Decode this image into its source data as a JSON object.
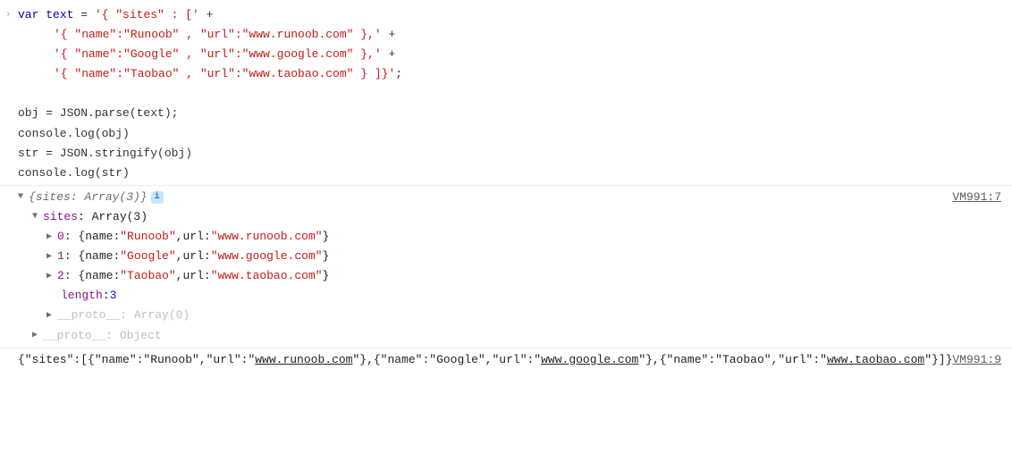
{
  "input": {
    "line1_kw": "var",
    "line1_var": "text",
    "line1_eq": " = ",
    "line1_str": "'{ \"sites\" : ['",
    "line1_plus": " +",
    "line2_str": "'{ \"name\":\"Runoob\" , \"url\":\"www.runoob.com\" },'",
    "line2_plus": " +",
    "line3_str": "'{ \"name\":\"Google\" , \"url\":\"www.google.com\" },'",
    "line3_plus": " +",
    "line4_str": "'{ \"name\":\"Taobao\" , \"url\":\"www.taobao.com\" } ]}'",
    "line4_semi": ";",
    "line6": "obj = JSON.parse(text);",
    "line7": "console.log(obj)",
    "line8": "str = JSON.stringify(obj)",
    "line9": "console.log(str)"
  },
  "tree": {
    "root": "{sites: Array(3)}",
    "info": "i",
    "sites_label": "sites",
    "sites_type": ": Array(3)",
    "items": [
      {
        "idx": "0",
        "name_key": "name",
        "name_val": "\"Runoob\"",
        "url_key": "url",
        "url_val": "\"www.runoob.com\""
      },
      {
        "idx": "1",
        "name_key": "name",
        "name_val": "\"Google\"",
        "url_key": "url",
        "url_val": "\"www.google.com\""
      },
      {
        "idx": "2",
        "name_key": "name",
        "name_val": "\"Taobao\"",
        "url_key": "url",
        "url_val": "\"www.taobao.com\""
      }
    ],
    "length_key": "length",
    "length_val": "3",
    "proto_arr": "__proto__",
    "proto_arr_type": ": Array(0)",
    "proto_obj": "__proto__",
    "proto_obj_type": ": Object"
  },
  "stringout": {
    "seg1": "{\"sites\":[{\"name\":\"Runoob\",\"url\":\"",
    "link1": "www.runoob.com",
    "seg2": "\"},{\"name\":\"Google\",\"url\":\"",
    "link2": "www.google.com",
    "seg3": "\"},{\"name\":\"Taobao\",\"url\":\"",
    "link3": "www.taobao.com",
    "seg4": "\"}]}"
  },
  "source": {
    "first": "VM991:7",
    "second": "VM991:9"
  }
}
